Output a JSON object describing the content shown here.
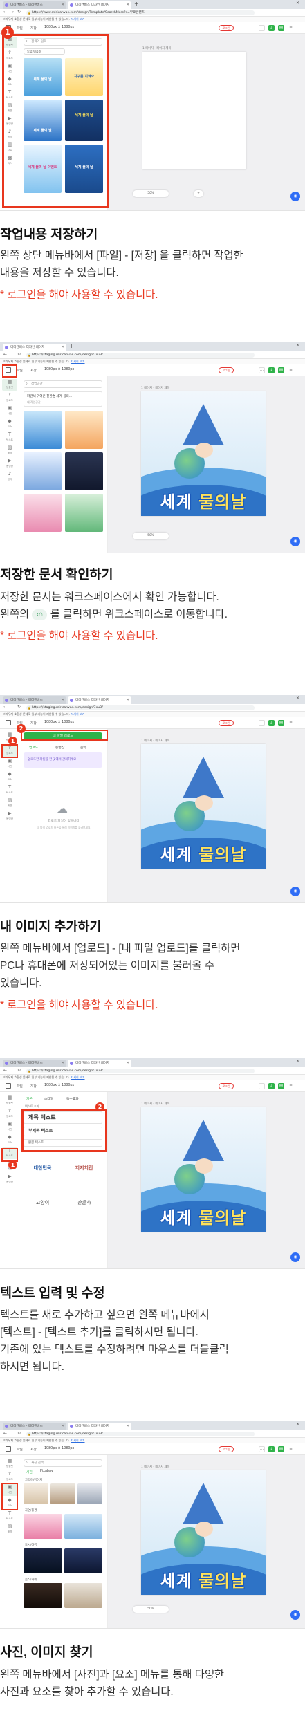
{
  "colors": {
    "accent_red": "#e8361e",
    "brand_green": "#2fb34a",
    "canvas_blue": "#2e73c6"
  },
  "browser": {
    "tab1": "미리캔버스 - 미리캔버스",
    "tab2": "미리캔버스 디자인 페이지",
    "url1": "https://www.miricanvas.com/design/Template/SearchMore?s=무료콘텐츠",
    "url2": "https://staging.miricanvas.com/design/7xu3f",
    "notice": "브라우저 호환성 문제로 일부 기능이 제한될 수 있습니다.",
    "notice_link": "자세히 보기",
    "login": "로그인",
    "save": "저장하기"
  },
  "toolbar": {
    "file": "파일",
    "save_menu": "저장",
    "size": "1080px × 1080px",
    "undo_icon": "undo-icon"
  },
  "rail": [
    "템플릿",
    "업로드",
    "사진",
    "요소",
    "텍스트",
    "배경",
    "동영상",
    "음악",
    "차트",
    "QR"
  ],
  "canvas": {
    "page_label": "1 페이지 - 페이지 제목",
    "zoom": "50%",
    "poster_title_a": "세계 ",
    "poster_title_b": "물의날"
  },
  "step1": {
    "search_placeholder": "검색어 입력",
    "filter": "무료 템플릿",
    "thumbs": [
      "세계 물의 날",
      "지구를 지켜요",
      "세계 물의 날",
      "세계 물의 날 이벤트"
    ],
    "title": "작업내용 저장하기",
    "body": [
      "왼쪽 상단 메뉴바에서 [파일] - [저장] 을 클릭하면 작업한",
      "내용을 저장할 수 있습니다."
    ],
    "note": "* 로그인을 해야 사용할 수 있습니다."
  },
  "step2": {
    "search_placeholder": "작업공간",
    "doc_title": "파란색 귀여운 친환경 세계 물의...",
    "folder": "내 작업공간",
    "title": "저장한 문서 확인하기",
    "body_line1": "저장한 문서는 워크스페이스에서 확인 가능합니다.",
    "body_pre": "왼쪽의",
    "body_post": "를 클릭하면 워크스페이스로 이동합니다.",
    "note": "* 로그인을 해야 사용할 수 있습니다."
  },
  "step3": {
    "upload_button": "내 파일 업로드",
    "tabs": [
      "업로드",
      "동영상",
      "음악"
    ],
    "banner": "업로드한 파일을 한 곳에서 관리하세요",
    "drop_hint": "업로드 파일이 없습니다",
    "drop_sub": "내 파일 업로드 버튼을 눌러 이미지를 올려보세요",
    "title": "내 이미지 추가하기",
    "body": [
      "왼쪽 메뉴바에서 [업로드] - [내 파일 업로드]를 클릭하면",
      "PC나 휴대폰에 저장되어있는 이미지를 불러올 수",
      "있습니다."
    ],
    "note": "* 로그인을 해야 사용할 수 있습니다."
  },
  "step4": {
    "tabs": [
      "기본",
      "스타일",
      "특수효과"
    ],
    "add_text": "텍스트 추가",
    "title_text": "제목 텍스트",
    "subtitle_text": "부제목 텍스트",
    "body_text": "본문 텍스트",
    "samples": [
      "대한민국",
      "지지치킨",
      "고양이",
      "손글씨"
    ],
    "title": "텍스트 입력 및 수정",
    "body": [
      "텍스트를 새로 추가하고 싶으면 왼쪽 메뉴바에서",
      "[텍스트] - [텍스트 추가]를 클릭하시면 됩니다.",
      "기존에 있는 텍스트를 수정하려면 마우스를 더블클릭",
      "하시면 됩니다."
    ]
  },
  "step5": {
    "search_placeholder": "사진 검색",
    "tabs": [
      "사진",
      "Pixabay"
    ],
    "groups": [
      "고양이/강아지",
      "자연/풍경",
      "도시/야경",
      "음식/카페"
    ],
    "title": "사진, 이미지 찾기",
    "body": [
      "왼쪽 메뉴바에서 [사진]과 [요소] 메뉴를 통해 다양한",
      "사진과 요소를 찾아 추가할 수 있습니다."
    ]
  }
}
